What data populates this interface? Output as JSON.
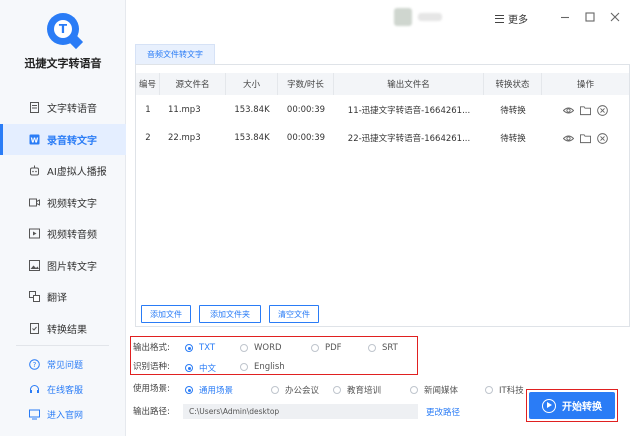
{
  "app": {
    "title": "迅捷文字转语音",
    "logo_letter": "T"
  },
  "sidebar": {
    "items": [
      {
        "label": "文字转语音",
        "icon": "text-doc-icon"
      },
      {
        "label": "录音转文字",
        "icon": "word-icon",
        "active": true
      },
      {
        "label": "AI虚拟人播报",
        "icon": "robot-icon"
      },
      {
        "label": "视频转文字",
        "icon": "video-icon"
      },
      {
        "label": "视频转音频",
        "icon": "video-audio-icon"
      },
      {
        "label": "图片转文字",
        "icon": "image-icon"
      },
      {
        "label": "翻译",
        "icon": "translate-icon"
      },
      {
        "label": "转换结果",
        "icon": "result-icon"
      }
    ],
    "footer": [
      {
        "label": "常见问题",
        "icon": "question-icon"
      },
      {
        "label": "在线客服",
        "icon": "headset-icon"
      },
      {
        "label": "进入官网",
        "icon": "monitor-icon"
      }
    ]
  },
  "titlebar": {
    "more": "更多"
  },
  "tab": {
    "label": "音频文件转文字"
  },
  "table": {
    "headers": [
      "编号",
      "源文件名",
      "大小",
      "字数/时长",
      "输出文件名",
      "转换状态",
      "操作"
    ],
    "rows": [
      {
        "no": "1",
        "name": "11.mp3",
        "size": "153.84K",
        "duration": "00:00:39",
        "output": "11-迅捷文字转语音-1664261...",
        "status": "待转换"
      },
      {
        "no": "2",
        "name": "22.mp3",
        "size": "153.84K",
        "duration": "00:00:39",
        "output": "22-迅捷文字转语音-1664261...",
        "status": "待转换"
      }
    ]
  },
  "buttons": {
    "add_file": "添加文件",
    "add_folder": "添加文件夹",
    "clear": "清空文件"
  },
  "format": {
    "label": "输出格式:",
    "options": [
      "TXT",
      "WORD",
      "PDF",
      "SRT"
    ],
    "selected": "TXT"
  },
  "language": {
    "label": "识别语种:",
    "options": [
      "中文",
      "English"
    ],
    "selected": "中文"
  },
  "scene": {
    "label": "使用场景:",
    "options": [
      "通用场景",
      "办公会议",
      "教育培训",
      "新闻媒体",
      "IT科技"
    ],
    "selected": "通用场景"
  },
  "output": {
    "label": "输出路径:",
    "path": "C:\\Users\\Admin\\desktop",
    "change": "更改路径"
  },
  "start": {
    "label": "开始转换"
  },
  "colors": {
    "accent": "#2a7cf6",
    "highlight": "#e02020"
  }
}
